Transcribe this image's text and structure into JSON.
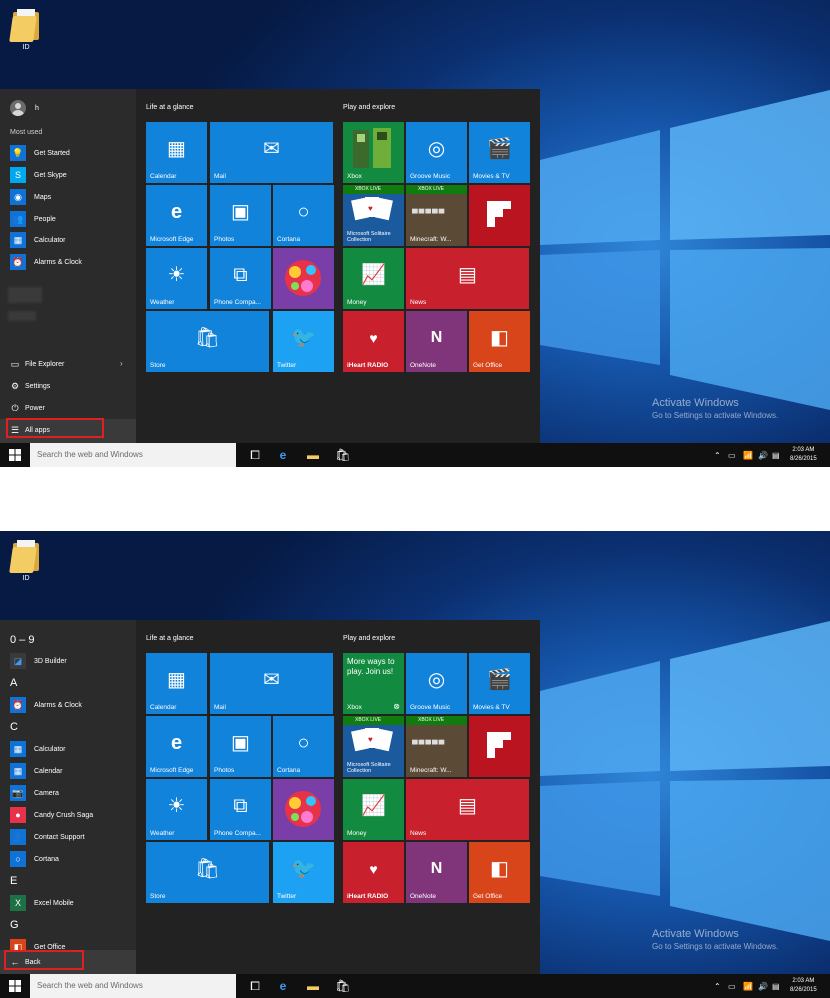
{
  "desktop": {
    "folder_label": "ID",
    "activate_title": "Activate Windows",
    "activate_sub": "Go to Settings to activate Windows."
  },
  "taskbar": {
    "search_placeholder": "Search the web and Windows",
    "time": "2:03 AM",
    "date": "8/26/2015"
  },
  "tiles": {
    "group1": "Life at a glance",
    "group2": "Play and explore",
    "calendar": "Calendar",
    "mail": "Mail",
    "edge": "Microsoft Edge",
    "photos": "Photos",
    "cortana": "Cortana",
    "weather": "Weather",
    "phone": "Phone Compa...",
    "store": "Store",
    "twitter": "Twitter",
    "xbox": "Xbox",
    "groove": "Groove Music",
    "movies": "Movies & TV",
    "xbox_live": "XBOX LIVE",
    "solitaire": "Microsoft Solitaire Collection",
    "minecraft": "Minecraft: W...",
    "money": "Money",
    "news": "News",
    "iheart": "iHeart RADIO",
    "onenote": "OneNote",
    "getoffice": "Get Office",
    "xbox_promo": "More ways to play. Join us!"
  },
  "menu1": {
    "user": "h",
    "most_used": "Most used",
    "apps": [
      "Get Started",
      "Get Skype",
      "Maps",
      "People",
      "Calculator",
      "Alarms & Clock"
    ],
    "file_explorer": "File Explorer",
    "settings": "Settings",
    "power": "Power",
    "all_apps": "All apps"
  },
  "menu2": {
    "h_09": "0 – 9",
    "app_3d": "3D Builder",
    "h_a": "A",
    "app_alarms": "Alarms & Clock",
    "h_c": "C",
    "app_calc": "Calculator",
    "app_calendar": "Calendar",
    "app_camera": "Camera",
    "app_candy": "Candy Crush Saga",
    "app_contact": "Contact Support",
    "app_cortana": "Cortana",
    "h_e": "E",
    "app_excel": "Excel Mobile",
    "h_g": "G",
    "app_getoffice": "Get Office",
    "back": "Back"
  }
}
